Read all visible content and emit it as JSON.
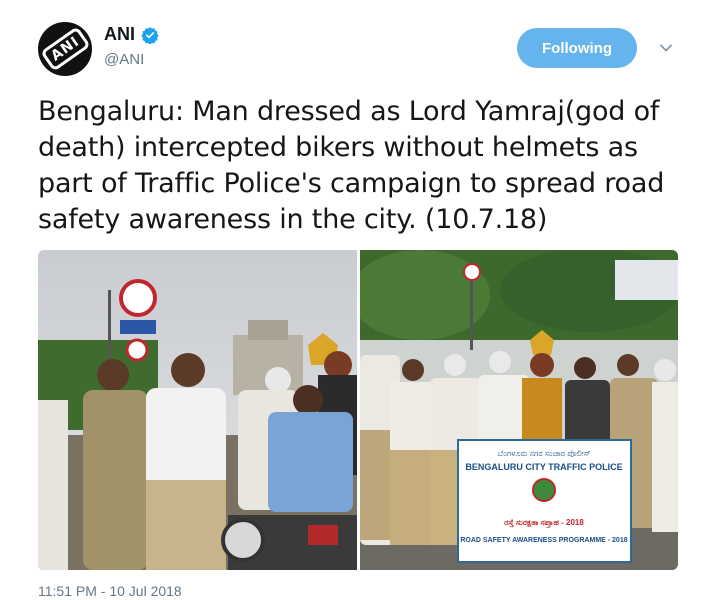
{
  "author": {
    "display_name": "ANI",
    "handle": "@ANI",
    "verified": true,
    "avatar_icon": "ani-logo-avatar",
    "avatar_text": "ANI"
  },
  "follow_button": {
    "label": "Following",
    "color": "#66b4ee"
  },
  "menu": {
    "icon": "chevron-down-icon"
  },
  "tweet": {
    "text": "Bengaluru: Man dressed as Lord Yamraj(god of death) intercepted bikers without helmets as part of Traffic Police's campaign to spread road safety awareness in the city. (10.7.18)"
  },
  "media": {
    "photos": [
      {
        "name": "photo-officers-with-biker"
      },
      {
        "name": "photo-traffic-police-banner"
      }
    ],
    "banner": {
      "line1": "ಬೆಂಗಳೂರು ನಗರ ಸಂಚಾರ ಪೊಲೀಸ್",
      "line2": "BENGALURU CITY TRAFFIC POLICE",
      "line3": "ರಸ್ತೆ ಸುರಕ್ಷತಾ ಸಪ್ತಾಹ - 2018",
      "line4": "ROAD SAFETY AWARENESS PROGRAMME - 2018"
    }
  },
  "timestamp": "11:51 PM - 10 Jul 2018",
  "colors": {
    "text": "#14171a",
    "secondary": "#657786",
    "verified_blue": "#1da1f2"
  }
}
